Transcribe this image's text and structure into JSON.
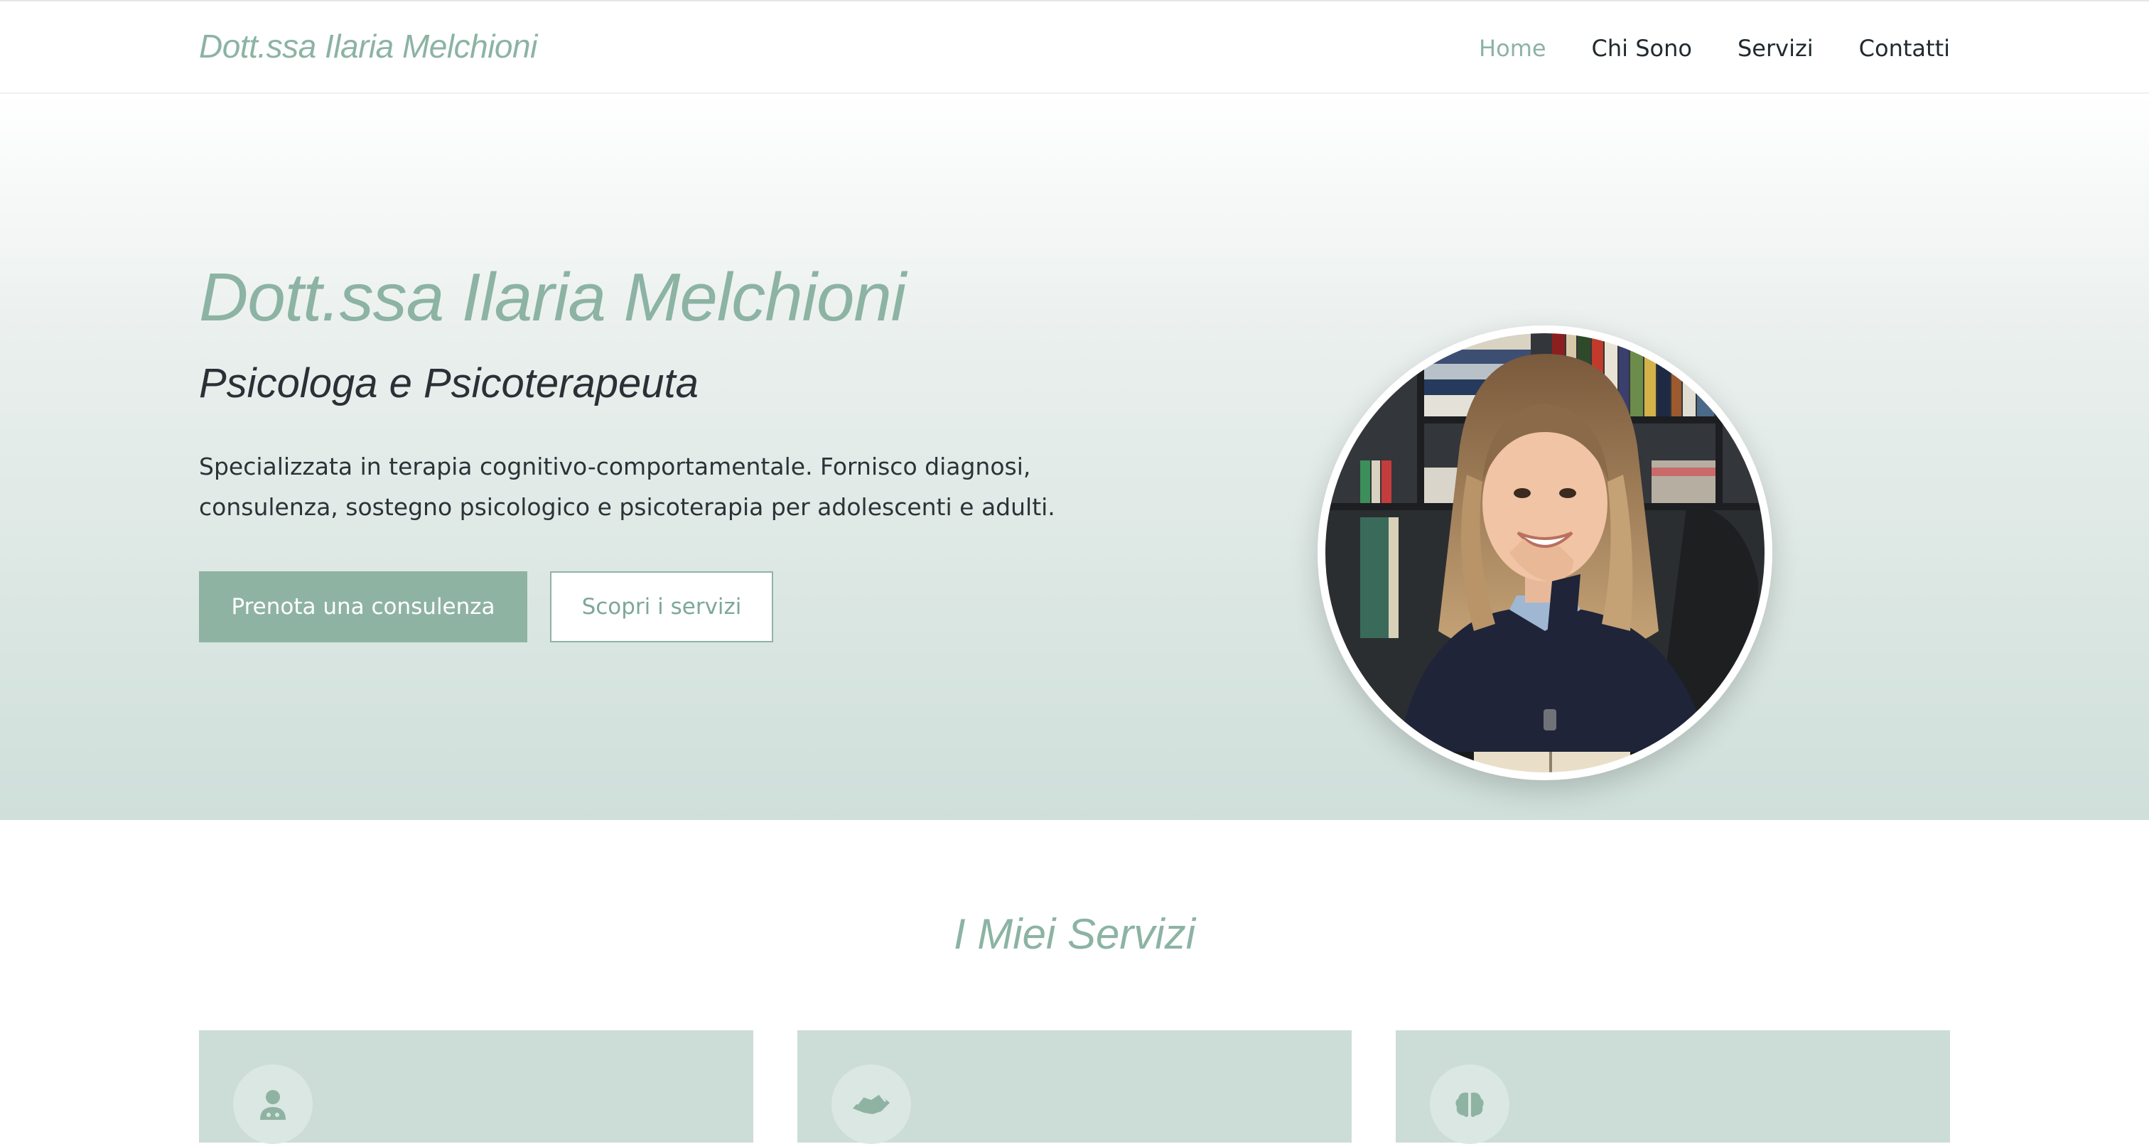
{
  "header": {
    "brand": "Dott.ssa Ilaria Melchioni",
    "nav": [
      {
        "label": "Home",
        "active": true
      },
      {
        "label": "Chi Sono",
        "active": false
      },
      {
        "label": "Servizi",
        "active": false
      },
      {
        "label": "Contatti",
        "active": false
      }
    ]
  },
  "hero": {
    "title": "Dott.ssa Ilaria Melchioni",
    "subtitle": "Psicologa e Psicoterapeuta",
    "description": "Specializzata in terapia cognitivo-comportamentale. Fornisco diagnosi, consulenza, sostegno psicologico e psicoterapia per adolescenti e adulti.",
    "primary_button": "Prenota una consulenza",
    "secondary_button": "Scopri i servizi",
    "portrait_alt": "portrait-photo"
  },
  "services": {
    "title": "I Miei Servizi",
    "cards": [
      {
        "icon": "user-doctor-icon"
      },
      {
        "icon": "handshake-icon"
      },
      {
        "icon": "brain-icon"
      }
    ]
  },
  "colors": {
    "accent": "#8cb3a3",
    "text_dark": "#222a2e",
    "card_bg": "#ccdcd6",
    "hero_gradient_end": "#cfdfda"
  }
}
